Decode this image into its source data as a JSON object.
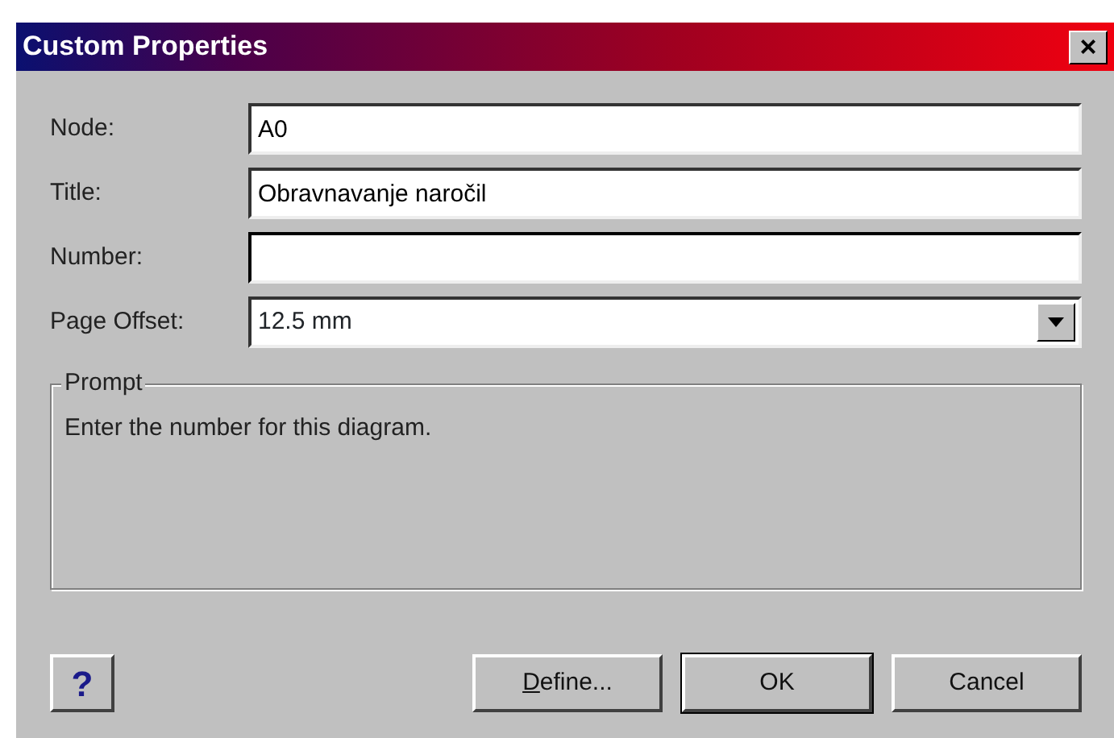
{
  "window": {
    "title": "Custom Properties",
    "close": "×"
  },
  "fields": [
    {
      "label": "Node:",
      "value": "A0",
      "kind": "text"
    },
    {
      "label": "Title:",
      "value": "Obravnavanje naročil",
      "kind": "text"
    },
    {
      "label": "Number:",
      "kind": "text",
      "focused": true
    },
    {
      "label": "Page Offset:",
      "value": "12.5 mm",
      "kind": "dropdown"
    }
  ],
  "prompt": {
    "legend": "Prompt",
    "text": "Enter the number for this diagram."
  },
  "help_button": "?",
  "buttons": [
    {
      "label": "Define...",
      "mnemonic": true,
      "default": false
    },
    {
      "label": "OK",
      "mnemonic": false,
      "default": true
    },
    {
      "label": "Cancel",
      "mnemonic": false,
      "default": false
    }
  ]
}
